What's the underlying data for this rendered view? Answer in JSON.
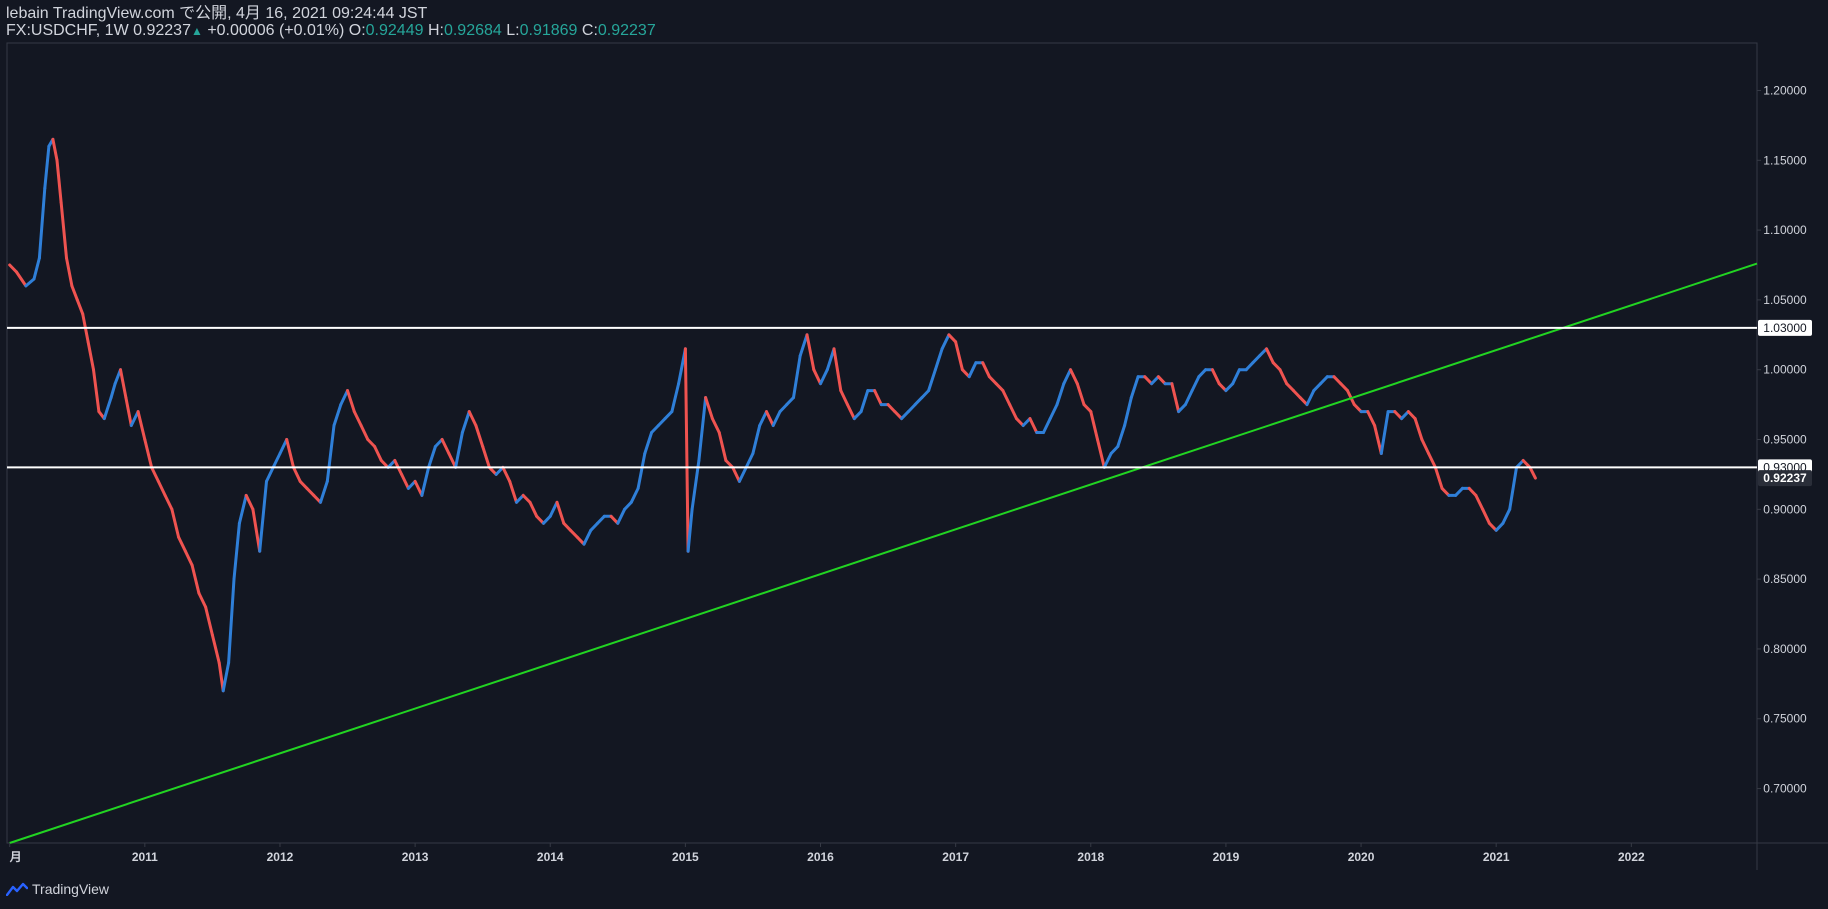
{
  "header": {
    "publisher": "lebain TradingView.com で公開, 4月 16, 2021 09:24:44 JST",
    "symbol": "FX:USDCHF, 1W",
    "last": "0.92237",
    "change": "+0.00006 (+0.01%)",
    "o_label": "O:",
    "o_value": "0.92449",
    "h_label": "H:",
    "h_value": "0.92684",
    "l_label": "L:",
    "l_value": "0.91869",
    "c_label": "C:",
    "c_value": "0.92237"
  },
  "footer": {
    "brand": "TradingView"
  },
  "colors": {
    "background": "#131722",
    "up": "#2f7fd8",
    "down": "#ef5350",
    "trendline": "#22d422",
    "hline": "#ffffff",
    "axis_text": "#d1d4dc",
    "axis_line": "#363a45"
  },
  "chart_data": {
    "type": "line",
    "series": [
      {
        "values": [
          [
            2010.0,
            1.075
          ],
          [
            2010.05,
            1.07
          ],
          [
            2010.12,
            1.06
          ],
          [
            2010.18,
            1.065
          ],
          [
            2010.22,
            1.08
          ],
          [
            2010.26,
            1.13
          ],
          [
            2010.29,
            1.16
          ],
          [
            2010.32,
            1.165
          ],
          [
            2010.35,
            1.15
          ],
          [
            2010.38,
            1.12
          ],
          [
            2010.42,
            1.08
          ],
          [
            2010.46,
            1.06
          ],
          [
            2010.5,
            1.05
          ],
          [
            2010.54,
            1.04
          ],
          [
            2010.58,
            1.02
          ],
          [
            2010.62,
            1.0
          ],
          [
            2010.66,
            0.97
          ],
          [
            2010.7,
            0.965
          ],
          [
            2010.75,
            0.98
          ],
          [
            2010.78,
            0.99
          ],
          [
            2010.82,
            1.0
          ],
          [
            2010.86,
            0.98
          ],
          [
            2010.9,
            0.96
          ],
          [
            2010.95,
            0.97
          ],
          [
            2011.0,
            0.95
          ],
          [
            2011.05,
            0.93
          ],
          [
            2011.1,
            0.92
          ],
          [
            2011.15,
            0.91
          ],
          [
            2011.2,
            0.9
          ],
          [
            2011.25,
            0.88
          ],
          [
            2011.3,
            0.87
          ],
          [
            2011.35,
            0.86
          ],
          [
            2011.4,
            0.84
          ],
          [
            2011.45,
            0.83
          ],
          [
            2011.5,
            0.81
          ],
          [
            2011.55,
            0.79
          ],
          [
            2011.58,
            0.77
          ],
          [
            2011.62,
            0.79
          ],
          [
            2011.66,
            0.85
          ],
          [
            2011.7,
            0.89
          ],
          [
            2011.75,
            0.91
          ],
          [
            2011.8,
            0.9
          ],
          [
            2011.85,
            0.87
          ],
          [
            2011.9,
            0.92
          ],
          [
            2011.95,
            0.93
          ],
          [
            2012.0,
            0.94
          ],
          [
            2012.05,
            0.95
          ],
          [
            2012.1,
            0.93
          ],
          [
            2012.15,
            0.92
          ],
          [
            2012.2,
            0.915
          ],
          [
            2012.25,
            0.91
          ],
          [
            2012.3,
            0.905
          ],
          [
            2012.35,
            0.92
          ],
          [
            2012.4,
            0.96
          ],
          [
            2012.45,
            0.975
          ],
          [
            2012.5,
            0.985
          ],
          [
            2012.55,
            0.97
          ],
          [
            2012.6,
            0.96
          ],
          [
            2012.65,
            0.95
          ],
          [
            2012.7,
            0.945
          ],
          [
            2012.75,
            0.935
          ],
          [
            2012.8,
            0.93
          ],
          [
            2012.85,
            0.935
          ],
          [
            2012.9,
            0.925
          ],
          [
            2012.95,
            0.915
          ],
          [
            2013.0,
            0.92
          ],
          [
            2013.05,
            0.91
          ],
          [
            2013.1,
            0.93
          ],
          [
            2013.15,
            0.945
          ],
          [
            2013.2,
            0.95
          ],
          [
            2013.25,
            0.94
          ],
          [
            2013.3,
            0.93
          ],
          [
            2013.35,
            0.955
          ],
          [
            2013.4,
            0.97
          ],
          [
            2013.45,
            0.96
          ],
          [
            2013.5,
            0.945
          ],
          [
            2013.55,
            0.93
          ],
          [
            2013.6,
            0.925
          ],
          [
            2013.65,
            0.93
          ],
          [
            2013.7,
            0.92
          ],
          [
            2013.75,
            0.905
          ],
          [
            2013.8,
            0.91
          ],
          [
            2013.85,
            0.905
          ],
          [
            2013.9,
            0.895
          ],
          [
            2013.95,
            0.89
          ],
          [
            2014.0,
            0.895
          ],
          [
            2014.05,
            0.905
          ],
          [
            2014.1,
            0.89
          ],
          [
            2014.15,
            0.885
          ],
          [
            2014.2,
            0.88
          ],
          [
            2014.25,
            0.875
          ],
          [
            2014.3,
            0.885
          ],
          [
            2014.35,
            0.89
          ],
          [
            2014.4,
            0.895
          ],
          [
            2014.45,
            0.895
          ],
          [
            2014.5,
            0.89
          ],
          [
            2014.55,
            0.9
          ],
          [
            2014.6,
            0.905
          ],
          [
            2014.65,
            0.915
          ],
          [
            2014.7,
            0.94
          ],
          [
            2014.75,
            0.955
          ],
          [
            2014.8,
            0.96
          ],
          [
            2014.85,
            0.965
          ],
          [
            2014.9,
            0.97
          ],
          [
            2014.95,
            0.99
          ],
          [
            2015.0,
            1.015
          ],
          [
            2015.02,
            0.87
          ],
          [
            2015.05,
            0.9
          ],
          [
            2015.1,
            0.935
          ],
          [
            2015.15,
            0.98
          ],
          [
            2015.2,
            0.965
          ],
          [
            2015.25,
            0.955
          ],
          [
            2015.3,
            0.935
          ],
          [
            2015.35,
            0.93
          ],
          [
            2015.4,
            0.92
          ],
          [
            2015.45,
            0.93
          ],
          [
            2015.5,
            0.94
          ],
          [
            2015.55,
            0.96
          ],
          [
            2015.6,
            0.97
          ],
          [
            2015.65,
            0.96
          ],
          [
            2015.7,
            0.97
          ],
          [
            2015.75,
            0.975
          ],
          [
            2015.8,
            0.98
          ],
          [
            2015.85,
            1.01
          ],
          [
            2015.9,
            1.025
          ],
          [
            2015.95,
            1.0
          ],
          [
            2016.0,
            0.99
          ],
          [
            2016.05,
            1.0
          ],
          [
            2016.1,
            1.015
          ],
          [
            2016.15,
            0.985
          ],
          [
            2016.2,
            0.975
          ],
          [
            2016.25,
            0.965
          ],
          [
            2016.3,
            0.97
          ],
          [
            2016.35,
            0.985
          ],
          [
            2016.4,
            0.985
          ],
          [
            2016.45,
            0.975
          ],
          [
            2016.5,
            0.975
          ],
          [
            2016.55,
            0.97
          ],
          [
            2016.6,
            0.965
          ],
          [
            2016.65,
            0.97
          ],
          [
            2016.7,
            0.975
          ],
          [
            2016.75,
            0.98
          ],
          [
            2016.8,
            0.985
          ],
          [
            2016.85,
            1.0
          ],
          [
            2016.9,
            1.015
          ],
          [
            2016.95,
            1.025
          ],
          [
            2017.0,
            1.02
          ],
          [
            2017.05,
            1.0
          ],
          [
            2017.1,
            0.995
          ],
          [
            2017.15,
            1.005
          ],
          [
            2017.2,
            1.005
          ],
          [
            2017.25,
            0.995
          ],
          [
            2017.3,
            0.99
          ],
          [
            2017.35,
            0.985
          ],
          [
            2017.4,
            0.975
          ],
          [
            2017.45,
            0.965
          ],
          [
            2017.5,
            0.96
          ],
          [
            2017.55,
            0.965
          ],
          [
            2017.6,
            0.955
          ],
          [
            2017.65,
            0.955
          ],
          [
            2017.7,
            0.965
          ],
          [
            2017.75,
            0.975
          ],
          [
            2017.8,
            0.99
          ],
          [
            2017.85,
            1.0
          ],
          [
            2017.9,
            0.99
          ],
          [
            2017.95,
            0.975
          ],
          [
            2018.0,
            0.97
          ],
          [
            2018.05,
            0.95
          ],
          [
            2018.1,
            0.93
          ],
          [
            2018.15,
            0.94
          ],
          [
            2018.2,
            0.945
          ],
          [
            2018.25,
            0.96
          ],
          [
            2018.3,
            0.98
          ],
          [
            2018.35,
            0.995
          ],
          [
            2018.4,
            0.995
          ],
          [
            2018.45,
            0.99
          ],
          [
            2018.5,
            0.995
          ],
          [
            2018.55,
            0.99
          ],
          [
            2018.6,
            0.99
          ],
          [
            2018.65,
            0.97
          ],
          [
            2018.7,
            0.975
          ],
          [
            2018.75,
            0.985
          ],
          [
            2018.8,
            0.995
          ],
          [
            2018.85,
            1.0
          ],
          [
            2018.9,
            1.0
          ],
          [
            2018.95,
            0.99
          ],
          [
            2019.0,
            0.985
          ],
          [
            2019.05,
            0.99
          ],
          [
            2019.1,
            1.0
          ],
          [
            2019.15,
            1.0
          ],
          [
            2019.2,
            1.005
          ],
          [
            2019.25,
            1.01
          ],
          [
            2019.3,
            1.015
          ],
          [
            2019.35,
            1.005
          ],
          [
            2019.4,
            1.0
          ],
          [
            2019.45,
            0.99
          ],
          [
            2019.5,
            0.985
          ],
          [
            2019.55,
            0.98
          ],
          [
            2019.6,
            0.975
          ],
          [
            2019.65,
            0.985
          ],
          [
            2019.7,
            0.99
          ],
          [
            2019.75,
            0.995
          ],
          [
            2019.8,
            0.995
          ],
          [
            2019.85,
            0.99
          ],
          [
            2019.9,
            0.985
          ],
          [
            2019.95,
            0.975
          ],
          [
            2020.0,
            0.97
          ],
          [
            2020.05,
            0.97
          ],
          [
            2020.1,
            0.96
          ],
          [
            2020.15,
            0.94
          ],
          [
            2020.2,
            0.97
          ],
          [
            2020.25,
            0.97
          ],
          [
            2020.3,
            0.965
          ],
          [
            2020.35,
            0.97
          ],
          [
            2020.4,
            0.965
          ],
          [
            2020.45,
            0.95
          ],
          [
            2020.5,
            0.94
          ],
          [
            2020.55,
            0.93
          ],
          [
            2020.6,
            0.915
          ],
          [
            2020.65,
            0.91
          ],
          [
            2020.7,
            0.91
          ],
          [
            2020.75,
            0.915
          ],
          [
            2020.8,
            0.915
          ],
          [
            2020.85,
            0.91
          ],
          [
            2020.9,
            0.9
          ],
          [
            2020.95,
            0.89
          ],
          [
            2021.0,
            0.885
          ],
          [
            2021.05,
            0.89
          ],
          [
            2021.1,
            0.9
          ],
          [
            2021.15,
            0.93
          ],
          [
            2021.2,
            0.935
          ],
          [
            2021.25,
            0.93
          ],
          [
            2021.29,
            0.92237
          ]
        ]
      }
    ],
    "x_ticks": [
      {
        "x": 2010.0,
        "label": "月"
      },
      {
        "x": 2011.0,
        "label": "2011"
      },
      {
        "x": 2012.0,
        "label": "2012"
      },
      {
        "x": 2013.0,
        "label": "2013"
      },
      {
        "x": 2014.0,
        "label": "2014"
      },
      {
        "x": 2015.0,
        "label": "2015"
      },
      {
        "x": 2016.0,
        "label": "2016"
      },
      {
        "x": 2017.0,
        "label": "2017"
      },
      {
        "x": 2018.0,
        "label": "2018"
      },
      {
        "x": 2019.0,
        "label": "2019"
      },
      {
        "x": 2020.0,
        "label": "2020"
      },
      {
        "x": 2021.0,
        "label": "2021"
      },
      {
        "x": 2022.0,
        "label": "2022"
      }
    ],
    "y_ticks": [
      {
        "v": 1.2,
        "label": "1.20000"
      },
      {
        "v": 1.15,
        "label": "1.15000"
      },
      {
        "v": 1.1,
        "label": "1.10000"
      },
      {
        "v": 1.05,
        "label": "1.05000"
      },
      {
        "v": 1.0,
        "label": "1.00000"
      },
      {
        "v": 0.95,
        "label": "0.95000"
      },
      {
        "v": 0.9,
        "label": "0.90000"
      },
      {
        "v": 0.85,
        "label": "0.85000"
      },
      {
        "v": 0.8,
        "label": "0.80000"
      },
      {
        "v": 0.75,
        "label": "0.75000"
      },
      {
        "v": 0.7,
        "label": "0.70000"
      }
    ],
    "xlim": [
      2009.98,
      2022.93
    ],
    "ylim": [
      0.661,
      1.234
    ],
    "hlines": [
      {
        "v": 1.03,
        "label": "1.03000"
      },
      {
        "v": 0.93,
        "label": "0.93000"
      }
    ],
    "last_price": {
      "v": 0.92237,
      "label": "0.92237"
    },
    "trendline": {
      "x1": 2010.0,
      "y1": 0.661,
      "x2": 2022.93,
      "y2": 1.076
    },
    "grid": false
  }
}
